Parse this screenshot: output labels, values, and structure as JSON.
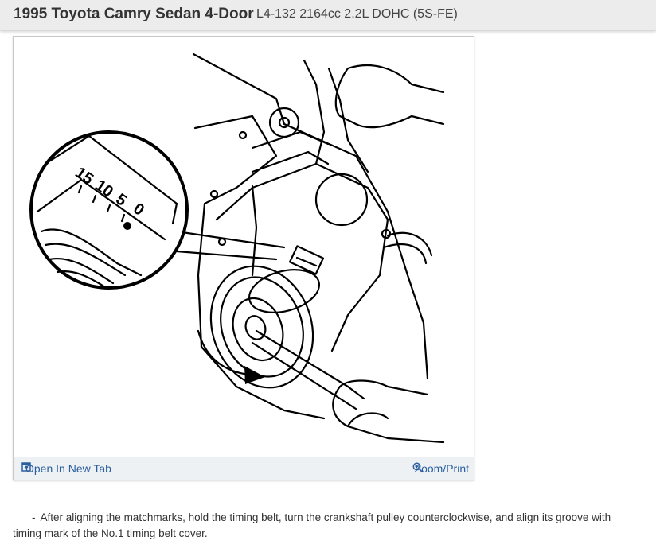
{
  "header": {
    "title": "1995 Toyota Camry Sedan 4-Door",
    "subtitle": "L4-132 2164cc 2.2L DOHC (5S-FE)"
  },
  "figure": {
    "inset_marks": [
      "15",
      "10",
      "5",
      "0"
    ],
    "open_tab_label": "Open In New Tab",
    "open_tab_icon": "open-in-new-tab-icon",
    "zoom_label": "Zoom/Print",
    "zoom_icon": "magnifier-icon",
    "link_color": "#2a5f9e"
  },
  "caption": {
    "bullet": "-",
    "text": "After aligning the matchmarks, hold the timing belt, turn the crankshaft pulley counterclockwise, and align its groove with timing mark of the No.1 timing belt cover."
  }
}
